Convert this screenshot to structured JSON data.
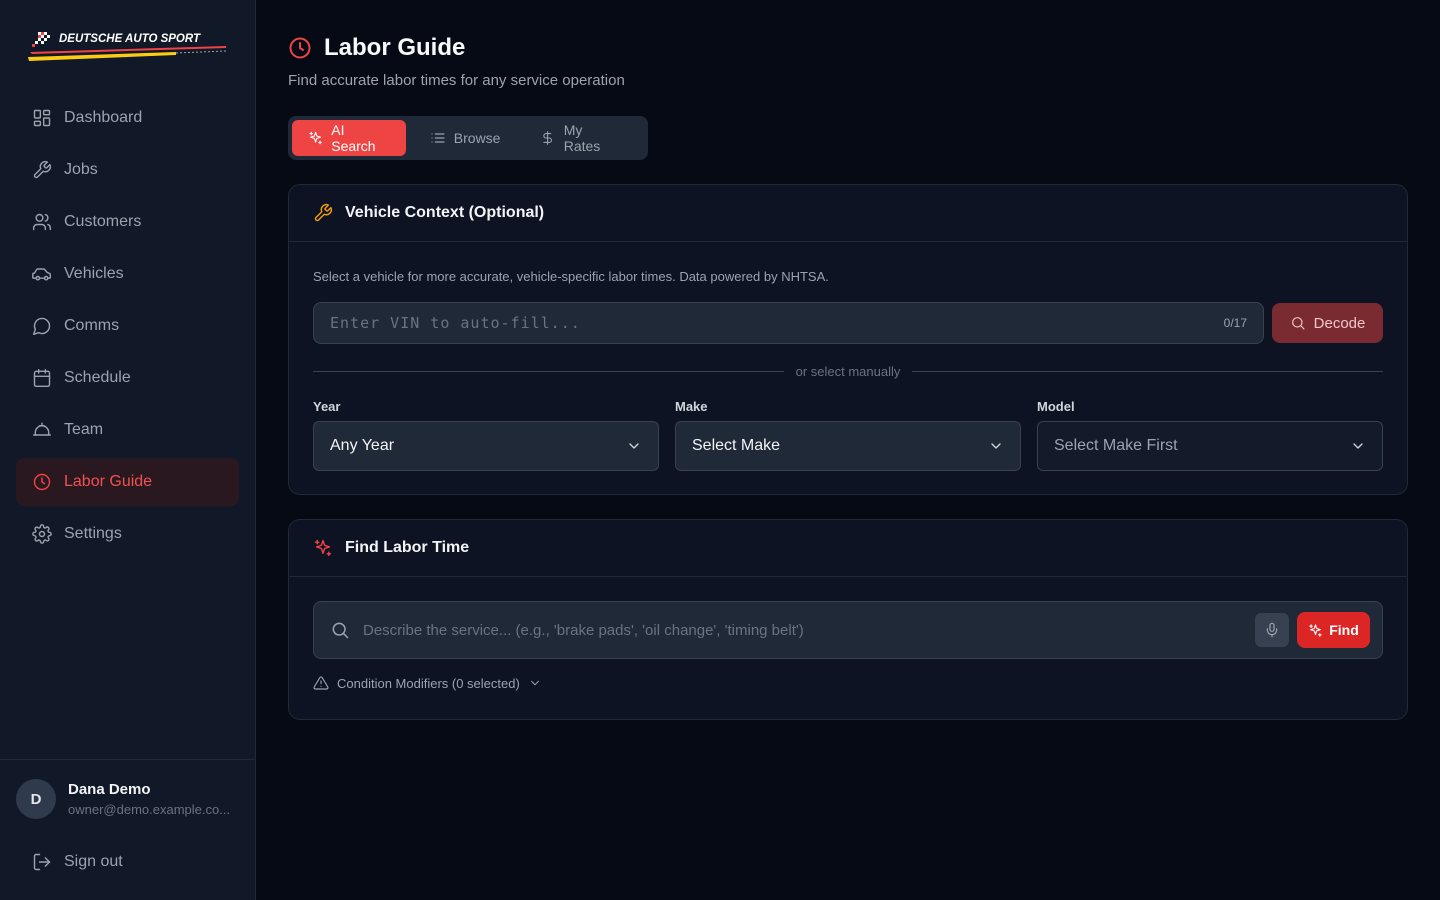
{
  "brand": {
    "logo_text": "DEUTSCHE AUTO SPORT"
  },
  "sidebar": {
    "items": [
      {
        "label": "Dashboard",
        "icon": "dashboard-icon"
      },
      {
        "label": "Jobs",
        "icon": "wrench-icon"
      },
      {
        "label": "Customers",
        "icon": "users-icon"
      },
      {
        "label": "Vehicles",
        "icon": "car-icon"
      },
      {
        "label": "Comms",
        "icon": "message-icon"
      },
      {
        "label": "Schedule",
        "icon": "calendar-icon"
      },
      {
        "label": "Team",
        "icon": "team-icon"
      },
      {
        "label": "Labor Guide",
        "icon": "clock-icon",
        "active": true
      },
      {
        "label": "Settings",
        "icon": "gear-icon"
      }
    ],
    "user": {
      "initial": "D",
      "name": "Dana Demo",
      "email": "owner@demo.example.co..."
    },
    "signout_label": "Sign out"
  },
  "page": {
    "title": "Labor Guide",
    "subtitle": "Find accurate labor times for any service operation"
  },
  "tabs": [
    {
      "label": "AI Search",
      "active": true
    },
    {
      "label": "Browse"
    },
    {
      "label": "My Rates"
    }
  ],
  "vehicle_context": {
    "title": "Vehicle Context (Optional)",
    "description": "Select a vehicle for more accurate, vehicle-specific labor times. Data powered by NHTSA.",
    "vin_placeholder": "Enter VIN to auto-fill...",
    "vin_count": "0/17",
    "decode_label": "Decode",
    "divider_text": "or select manually",
    "year": {
      "label": "Year",
      "value": "Any Year"
    },
    "make": {
      "label": "Make",
      "value": "Select Make"
    },
    "model": {
      "label": "Model",
      "value": "Select Make First"
    }
  },
  "find_labor": {
    "title": "Find Labor Time",
    "search_placeholder": "Describe the service... (e.g., 'brake pads', 'oil change', 'timing belt')",
    "find_label": "Find",
    "modifiers_label": "Condition Modifiers (0 selected)"
  },
  "colors": {
    "accent": "#ef4444",
    "background": "#060a14",
    "sidebar": "#111827",
    "card": "#0d1322",
    "wrench_icon": "#f59e0b"
  }
}
